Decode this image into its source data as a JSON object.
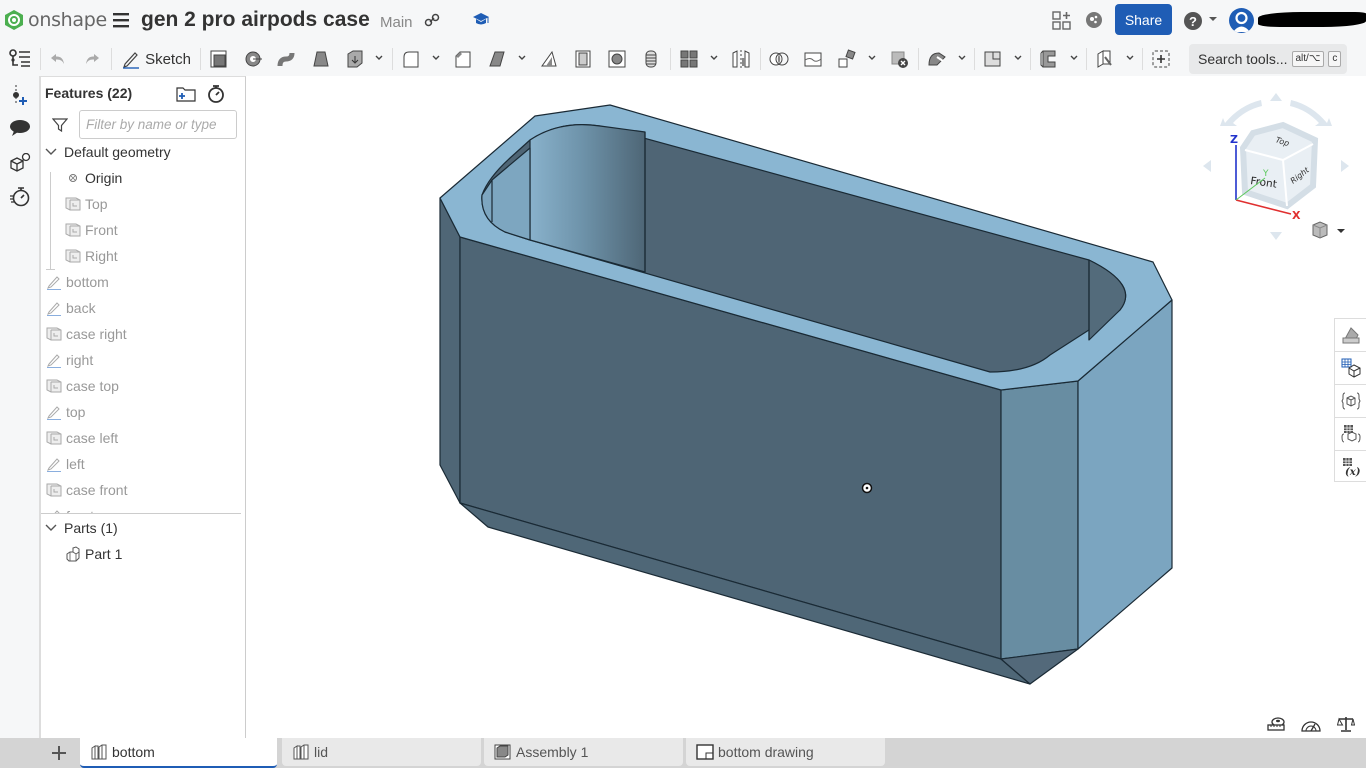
{
  "app": {
    "brand": "onshape",
    "document_title": "gen 2 pro airpods case",
    "branch": "Main",
    "share_label": "Share",
    "username_redacted": true,
    "accent_color": "#1f5db5"
  },
  "toolbar": {
    "sketch_label": "Sketch",
    "search_label": "Search tools...",
    "search_shortcut_1": "alt/⌥",
    "search_shortcut_2": "c",
    "tools": [
      "undo",
      "redo",
      "sketch",
      "extrude",
      "revolve",
      "sweep",
      "loft",
      "thicken",
      "fillet",
      "chamfer",
      "draft",
      "rib",
      "shell",
      "hole",
      "thread",
      "pattern",
      "mirror",
      "boolean",
      "split",
      "transform",
      "delete-part",
      "sheet-metal",
      "plane",
      "frame",
      "surface",
      "fit-spline",
      "add-feature"
    ]
  },
  "left_rail": [
    "feature-list",
    "add-mate-connector",
    "comments",
    "configurations",
    "performance"
  ],
  "features": {
    "title": "Features (22)",
    "filter_placeholder": "Filter by name or type",
    "default_geometry": {
      "label": "Default geometry",
      "items": [
        {
          "label": "Origin",
          "type": "origin"
        },
        {
          "label": "Top",
          "type": "plane"
        },
        {
          "label": "Front",
          "type": "plane"
        },
        {
          "label": "Right",
          "type": "plane"
        }
      ]
    },
    "items": [
      {
        "label": "bottom",
        "type": "sketch"
      },
      {
        "label": "back",
        "type": "sketch"
      },
      {
        "label": "case right",
        "type": "plane"
      },
      {
        "label": "right",
        "type": "sketch"
      },
      {
        "label": "case top",
        "type": "plane"
      },
      {
        "label": "top",
        "type": "sketch"
      },
      {
        "label": "case left",
        "type": "plane"
      },
      {
        "label": "left",
        "type": "sketch"
      },
      {
        "label": "case front",
        "type": "plane"
      },
      {
        "label": "front",
        "type": "sketch"
      }
    ],
    "parts": {
      "label": "Parts (1)",
      "items": [
        {
          "label": "Part 1"
        }
      ]
    }
  },
  "viewcube": {
    "faces": {
      "top": "Top",
      "front": "Front",
      "right": "Right"
    },
    "axes": {
      "x": "X",
      "y": "Y",
      "z": "Z"
    },
    "colors": {
      "x": "#e03030",
      "y": "#5cc85c",
      "z": "#2233cc"
    }
  },
  "model": {
    "face_light": "#8ab4d0",
    "face_mid": "#6a90a6",
    "face_dark": "#4e6575",
    "face_side": "#7ba5c0"
  },
  "tabs": [
    {
      "label": "bottom",
      "type": "part-studio",
      "active": true
    },
    {
      "label": "lid",
      "type": "part-studio",
      "active": false
    },
    {
      "label": "Assembly 1",
      "type": "assembly",
      "active": false
    },
    {
      "label": "bottom drawing",
      "type": "drawing",
      "active": false
    }
  ]
}
